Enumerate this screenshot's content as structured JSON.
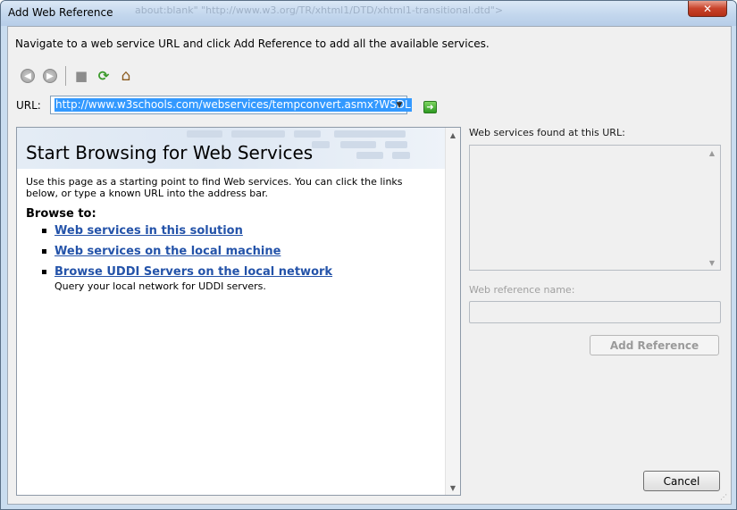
{
  "window": {
    "title": "Add Web Reference",
    "close_glyph": "✕",
    "background_text": "about:blank\"  \"http://www.w3.org/TR/xhtml1/DTD/xhtml1-transitional.dtd\">"
  },
  "instruction": "Navigate to a web service URL and click Add Reference to add all the available services.",
  "toolbar": {
    "buttons": [
      {
        "name": "back",
        "icon": "back-arrow-icon",
        "glyph": "◀"
      },
      {
        "name": "forward",
        "icon": "forward-arrow-icon",
        "glyph": "▶"
      },
      {
        "name": "stop",
        "icon": "stop-icon",
        "glyph": "■"
      },
      {
        "name": "refresh",
        "icon": "refresh-icon",
        "glyph": "⟳"
      },
      {
        "name": "home",
        "icon": "home-icon",
        "glyph": "⌂"
      }
    ]
  },
  "url": {
    "label": "URL:",
    "value": "http://www.w3schools.com/webservices/tempconvert.asmx?WSDL",
    "dropdown_glyph": "▼",
    "go_glyph": "➜"
  },
  "browser": {
    "title": "Start Browsing for Web Services",
    "description": "Use this page as a starting point to find Web services. You can click the links below, or type a known URL into the address bar.",
    "browse_to_label": "Browse to:",
    "links": [
      {
        "label": "Web services in this solution"
      },
      {
        "label": "Web services on the local machine"
      },
      {
        "label": "Browse UDDI Servers on the local network"
      }
    ],
    "uddi_description": "Query your local network for UDDI servers."
  },
  "right_panel": {
    "found_label": "Web services found at this URL:",
    "ref_name_label": "Web reference name:",
    "ref_name_value": "",
    "add_reference_label": "Add Reference"
  },
  "footer": {
    "cancel_label": "Cancel"
  },
  "colors": {
    "titlebar": "#c5d8ee",
    "client": "#f0f0f0",
    "link": "#2453a9",
    "url_selection": "#3399ff"
  }
}
